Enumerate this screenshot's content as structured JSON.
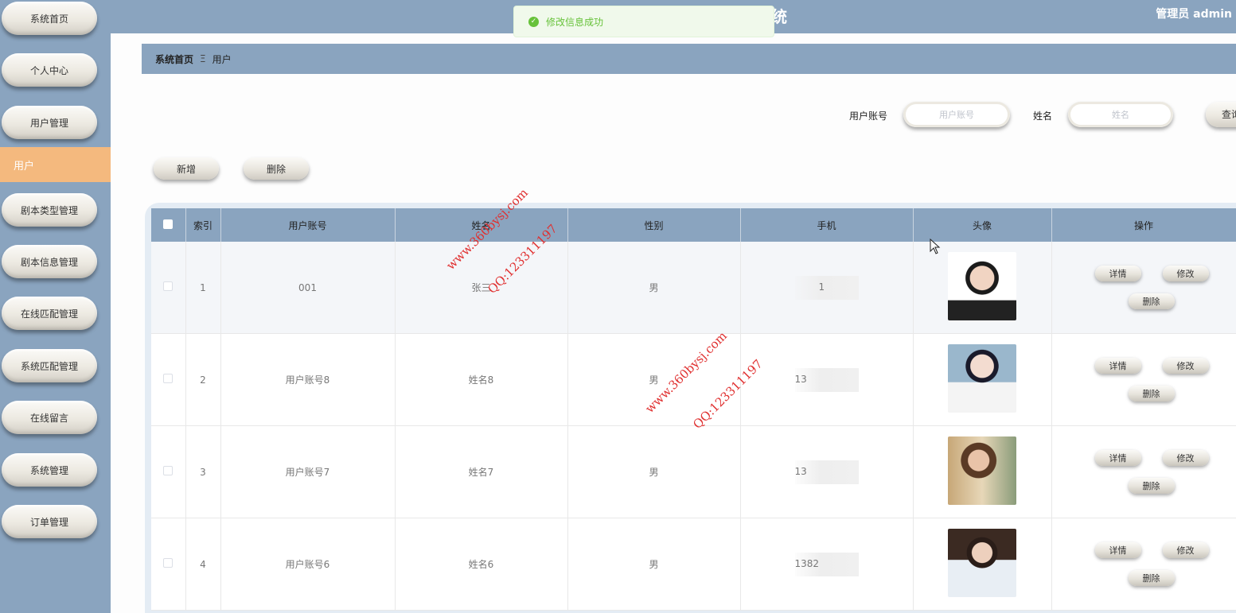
{
  "sidebar": {
    "items": [
      {
        "label": "系统首页"
      },
      {
        "label": "个人中心"
      },
      {
        "label": "用户管理"
      },
      {
        "label": "剧本类型管理"
      },
      {
        "label": "剧本信息管理"
      },
      {
        "label": "在线匹配管理"
      },
      {
        "label": "系统匹配管理"
      },
      {
        "label": "在线留言"
      },
      {
        "label": "系统管理"
      },
      {
        "label": "订单管理"
      }
    ],
    "active_sub": "用户"
  },
  "header": {
    "title_fragment": "统",
    "admin_label": "管理员 admin"
  },
  "toast": {
    "message": "修改信息成功"
  },
  "breadcrumb": {
    "home": "系统首页",
    "separator": "Ξ",
    "current": "用户"
  },
  "search": {
    "account_label": "用户账号",
    "account_placeholder": "用户账号",
    "name_label": "姓名",
    "name_placeholder": "姓名",
    "query_label": "查询"
  },
  "actions": {
    "add_label": "新增",
    "delete_label": "删除"
  },
  "table": {
    "headers": [
      "索引",
      "用户账号",
      "姓名",
      "性别",
      "手机",
      "头像",
      "操作"
    ],
    "rows": [
      {
        "index": "1",
        "account": "001",
        "name": "张三",
        "gender": "男",
        "phone": "1"
      },
      {
        "index": "2",
        "account": "用户账号8",
        "name": "姓名8",
        "gender": "男",
        "phone": "13"
      },
      {
        "index": "3",
        "account": "用户账号7",
        "name": "姓名7",
        "gender": "男",
        "phone": "13"
      },
      {
        "index": "4",
        "account": "用户账号6",
        "name": "姓名6",
        "gender": "男",
        "phone": "1382"
      }
    ],
    "op_labels": {
      "detail": "详情",
      "edit": "修改",
      "delete": "删除"
    }
  },
  "watermarks": [
    "www.360bysj.com",
    "QQ:123311197",
    "www.360bysj.com",
    "QQ:123311197"
  ]
}
